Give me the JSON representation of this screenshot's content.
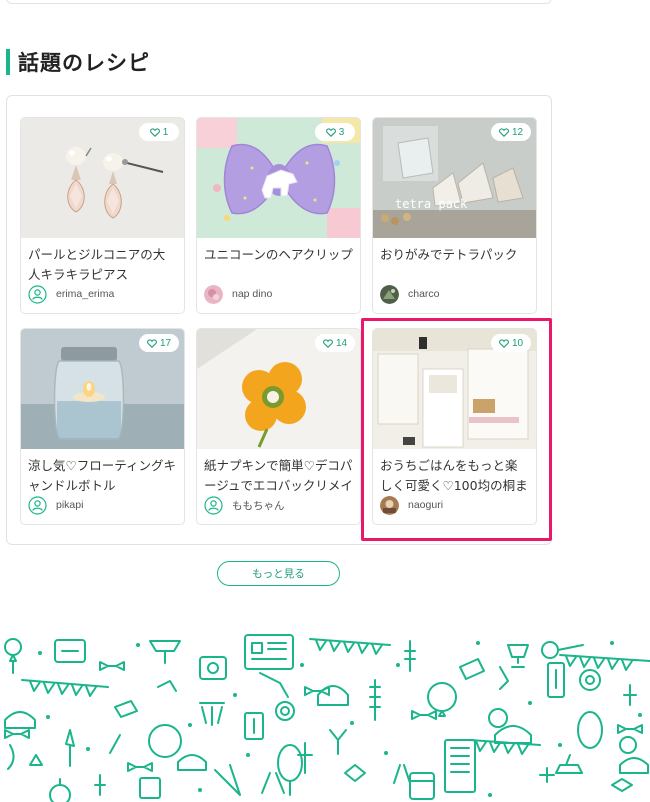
{
  "section": {
    "title": "話題のレシピ"
  },
  "recipes": [
    {
      "title": "パールとジルコニアの大人キラキラピアス",
      "likes": "1",
      "author": "erima_erima",
      "avatar": "default-user-icon"
    },
    {
      "title": "ユニコーンのヘアクリップ",
      "likes": "3",
      "author": "nap dino",
      "avatar": "photo-avatar"
    },
    {
      "title": "おりがみでテトラパック",
      "likes": "12",
      "author": "charco",
      "avatar": "photo-avatar"
    },
    {
      "title": "涼し気♡フローティングキャンドルボトル",
      "likes": "17",
      "author": "pikapi",
      "avatar": "default-user-icon"
    },
    {
      "title": "紙ナプキンで簡単♡デコパージュでエコバックリメイ",
      "likes": "14",
      "author": "ももちゃん",
      "avatar": "default-user-icon"
    },
    {
      "title": "おうちごはんをもっと楽しく可愛く♡100均の桐まな",
      "likes": "10",
      "author": "naoguri",
      "avatar": "photo-avatar"
    }
  ],
  "more_button": {
    "label": "もっと見る"
  },
  "colors": {
    "accent": "#1bb58c",
    "highlight": "#e8196a"
  },
  "icons": {
    "like": "heart-outline-icon",
    "default_avatar": "user-circle-icon"
  }
}
